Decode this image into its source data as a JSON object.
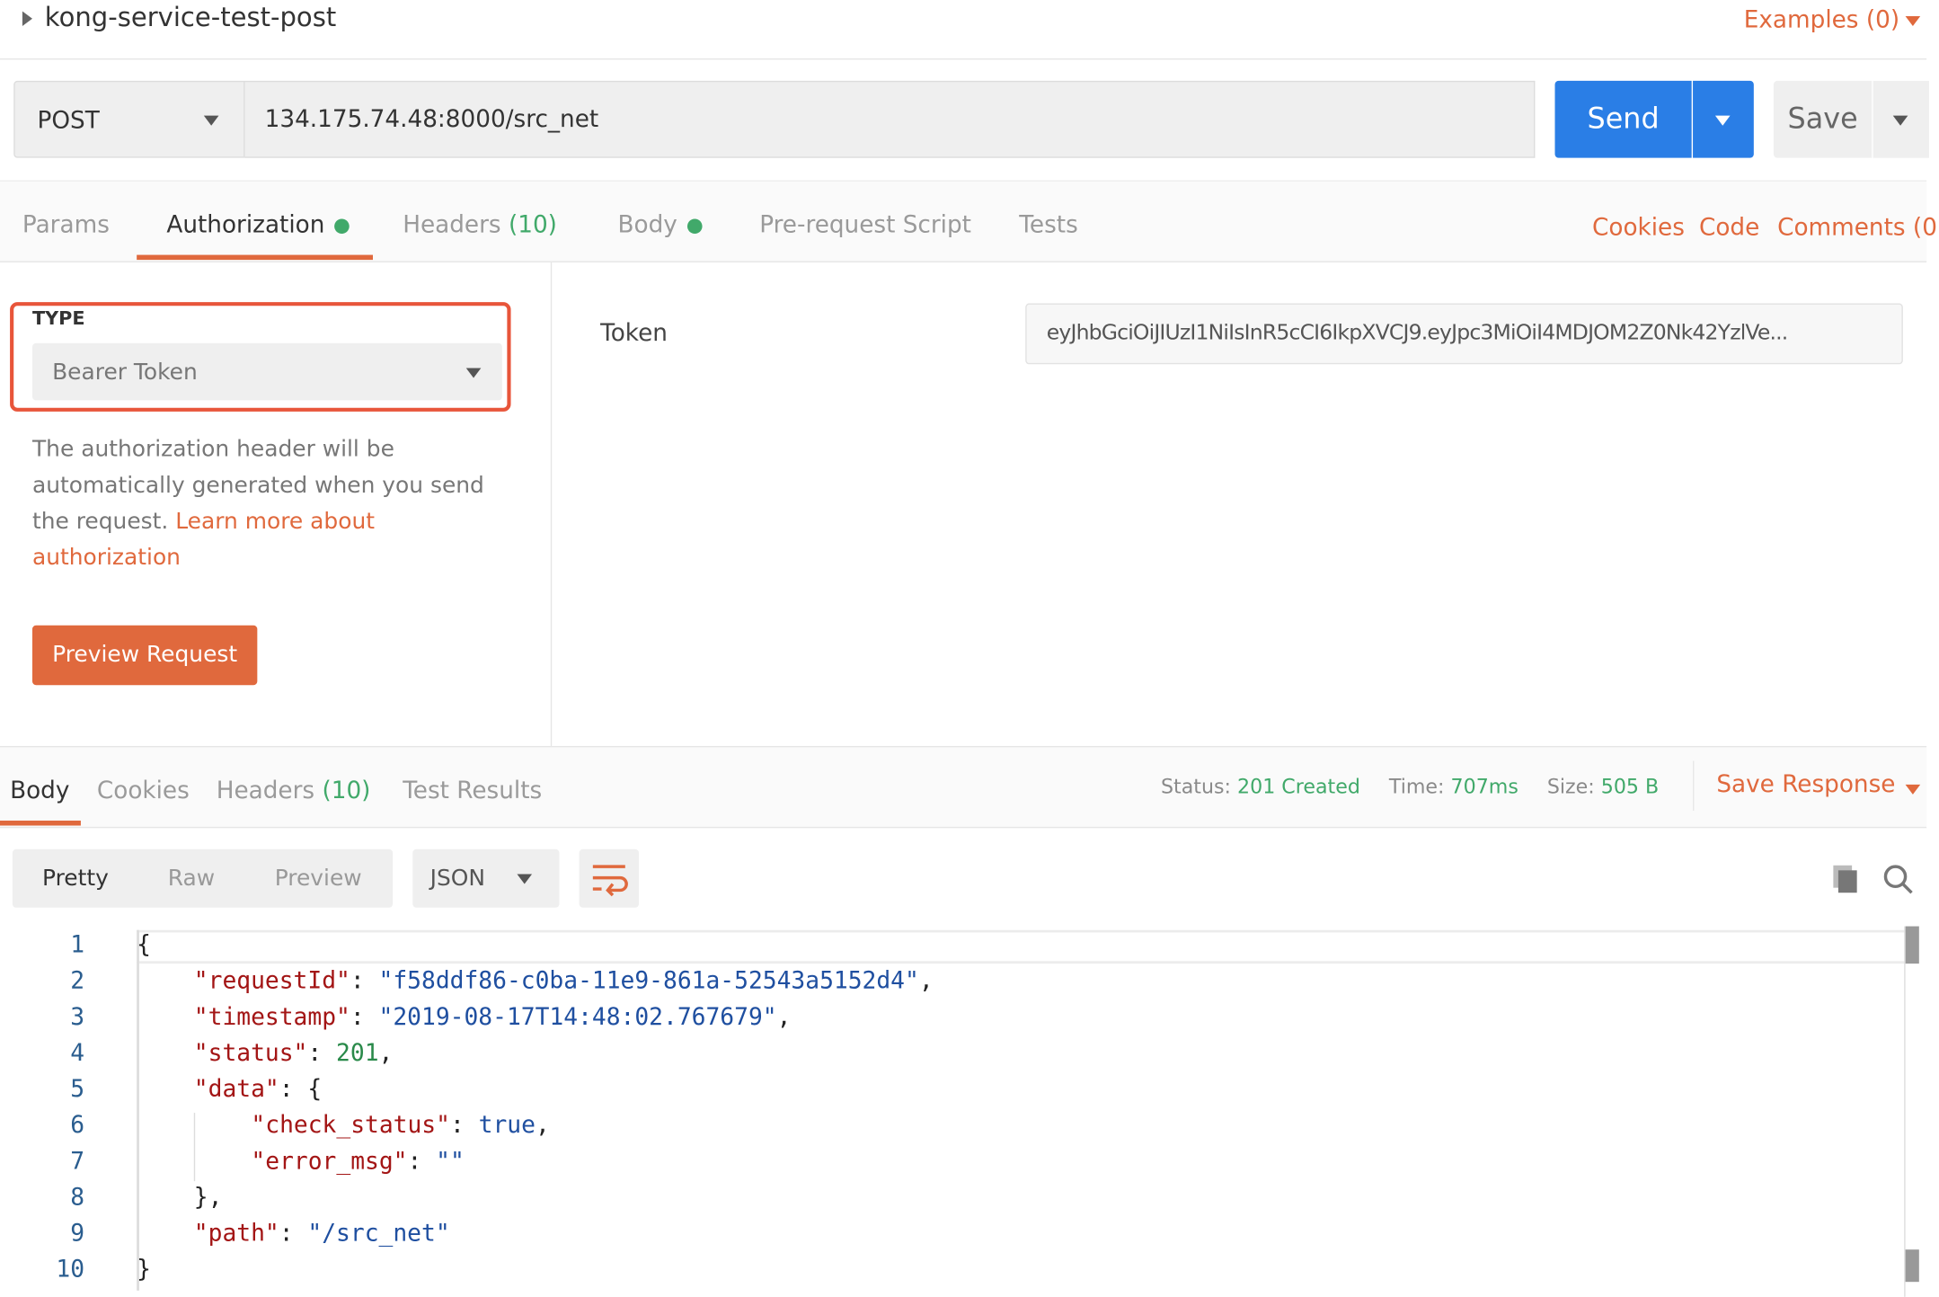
{
  "request": {
    "name": "kong-service-test-post",
    "examples_label": "Examples (0)",
    "method": "POST",
    "url": "134.175.74.48:8000/src_net",
    "send_label": "Send",
    "save_label": "Save"
  },
  "request_tabs": [
    {
      "label": "Params"
    },
    {
      "label": "Authorization",
      "dot": true,
      "active": true
    },
    {
      "label": "Headers",
      "count": "(10)"
    },
    {
      "label": "Body",
      "dot": true
    },
    {
      "label": "Pre-request Script"
    },
    {
      "label": "Tests"
    }
  ],
  "request_links": {
    "cookies": "Cookies",
    "code": "Code",
    "comments": "Comments (0"
  },
  "auth": {
    "type_label": "TYPE",
    "type_value": "Bearer Token",
    "description": "The authorization header will be automatically generated when you send the request.",
    "learn_more": "Learn more about authorization",
    "preview_button": "Preview Request",
    "token_label": "Token",
    "token_value": "eyJhbGciOiJIUzI1NiIsInR5cCI6IkpXVCJ9.eyJpc3MiOiI4MDJOM2Z0Nk42YzlVe..."
  },
  "response_tabs": [
    {
      "label": "Body",
      "active": true
    },
    {
      "label": "Cookies"
    },
    {
      "label": "Headers",
      "count": "(10)"
    },
    {
      "label": "Test Results"
    }
  ],
  "response_meta": {
    "status_label": "Status:",
    "status_value": "201 Created",
    "time_label": "Time:",
    "time_value": "707ms",
    "size_label": "Size:",
    "size_value": "505 B",
    "save_response": "Save Response"
  },
  "view_modes": {
    "pretty": "Pretty",
    "raw": "Raw",
    "preview": "Preview",
    "format": "JSON"
  },
  "code_lines": [
    [
      [
        "p",
        "{"
      ]
    ],
    [
      [
        "k",
        "\"requestId\""
      ],
      [
        "p",
        ": "
      ],
      [
        "s",
        "\"f58ddf86-c0ba-11e9-861a-52543a5152d4\""
      ],
      [
        "p",
        ","
      ]
    ],
    [
      [
        "k",
        "\"timestamp\""
      ],
      [
        "p",
        ": "
      ],
      [
        "s",
        "\"2019-08-17T14:48:02.767679\""
      ],
      [
        "p",
        ","
      ]
    ],
    [
      [
        "k",
        "\"status\""
      ],
      [
        "p",
        ": "
      ],
      [
        "n",
        "201"
      ],
      [
        "p",
        ","
      ]
    ],
    [
      [
        "k",
        "\"data\""
      ],
      [
        "p",
        ": {"
      ]
    ],
    [
      [
        "k",
        "\"check_status\""
      ],
      [
        "p",
        ": "
      ],
      [
        "b",
        "true"
      ],
      [
        "p",
        ","
      ]
    ],
    [
      [
        "k",
        "\"error_msg\""
      ],
      [
        "p",
        ": "
      ],
      [
        "s",
        "\"\""
      ]
    ],
    [
      [
        "p",
        "},"
      ]
    ],
    [
      [
        "k",
        "\"path\""
      ],
      [
        "p",
        ": "
      ],
      [
        "s",
        "\"/src_net\""
      ]
    ],
    [
      [
        "p",
        "}"
      ]
    ]
  ],
  "code_indent": [
    0,
    1,
    1,
    1,
    1,
    2,
    2,
    1,
    1,
    0
  ],
  "colors": {
    "accent": "#e0693d",
    "send": "#2a7ee6",
    "success": "#41a96a"
  }
}
